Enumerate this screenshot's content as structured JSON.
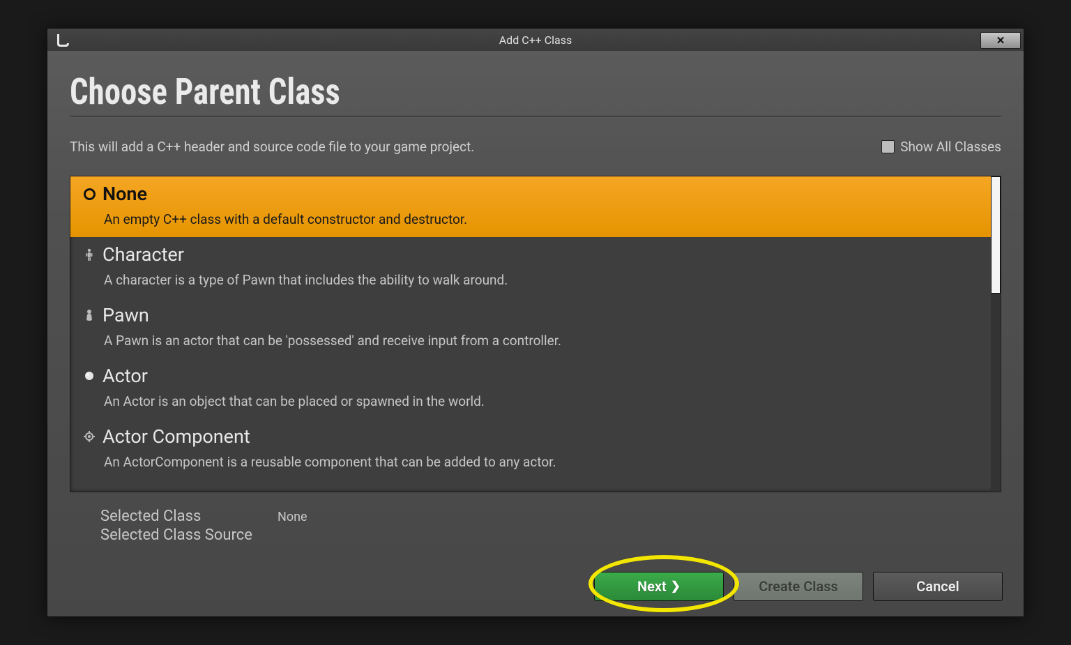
{
  "window_title": "Add C++ Class",
  "page_heading": "Choose Parent Class",
  "description": "This will add a C++ header and source code file to your game project.",
  "show_all_label": "Show All Classes",
  "classes": [
    {
      "name": "None",
      "desc": "An empty C++ class with a default constructor and destructor.",
      "selected": true,
      "icon": "radio"
    },
    {
      "name": "Character",
      "desc": "A character is a type of Pawn that includes the ability to walk around.",
      "selected": false,
      "icon": "character"
    },
    {
      "name": "Pawn",
      "desc": "A Pawn is an actor that can be 'possessed' and receive input from a controller.",
      "selected": false,
      "icon": "pawn"
    },
    {
      "name": "Actor",
      "desc": "An Actor is an object that can be placed or spawned in the world.",
      "selected": false,
      "icon": "actor"
    },
    {
      "name": "Actor Component",
      "desc": "An ActorComponent is a reusable component that can be added to any actor.",
      "selected": false,
      "icon": "component"
    }
  ],
  "selected_info": {
    "class_label": "Selected Class",
    "class_value": "None",
    "source_label": "Selected Class Source",
    "source_value": ""
  },
  "buttons": {
    "next": "Next",
    "create": "Create Class",
    "cancel": "Cancel"
  }
}
